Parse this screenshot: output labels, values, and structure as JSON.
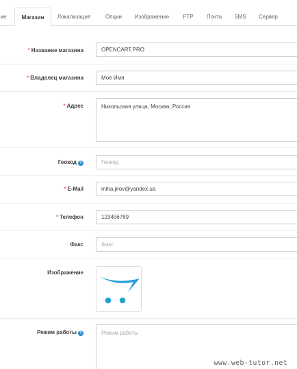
{
  "tabs": [
    {
      "label": "ие",
      "active": false
    },
    {
      "label": "Магазин",
      "active": true
    },
    {
      "label": "Локализация",
      "active": false
    },
    {
      "label": "Опции",
      "active": false
    },
    {
      "label": "Изображение",
      "active": false
    },
    {
      "label": "FTP",
      "active": false
    },
    {
      "label": "Почта",
      "active": false
    },
    {
      "label": "SMS",
      "active": false
    },
    {
      "label": "Сервер",
      "active": false
    }
  ],
  "form": {
    "store_name": {
      "label": "Название магазина",
      "required": "*",
      "value": "OPENCART.PRO"
    },
    "owner": {
      "label": "Владелец магазина",
      "required": "*",
      "value": "Мое Имя"
    },
    "address": {
      "label": "Адрес",
      "required": "*",
      "value": "Никольская улица, Москва, Россия"
    },
    "geocode": {
      "label": "Геокод",
      "help": "?",
      "placeholder": "Геокод"
    },
    "email": {
      "label": "E-Mail",
      "required": "*",
      "value": "miha.jirov@yandex.ua"
    },
    "phone": {
      "label": "Телефон",
      "required": "*",
      "value": "123456789"
    },
    "fax": {
      "label": "Факс",
      "placeholder": "Факс"
    },
    "image": {
      "label": "Изображение",
      "icon": "opencart-cart-logo"
    },
    "hours": {
      "label": "Режим работы",
      "help": "?",
      "placeholder": "Режим работы"
    }
  },
  "colors": {
    "required": "#f56b6b",
    "help": "#2a8fd0",
    "logo": "#23a1d1"
  },
  "watermark": "www.web-tutor.net"
}
